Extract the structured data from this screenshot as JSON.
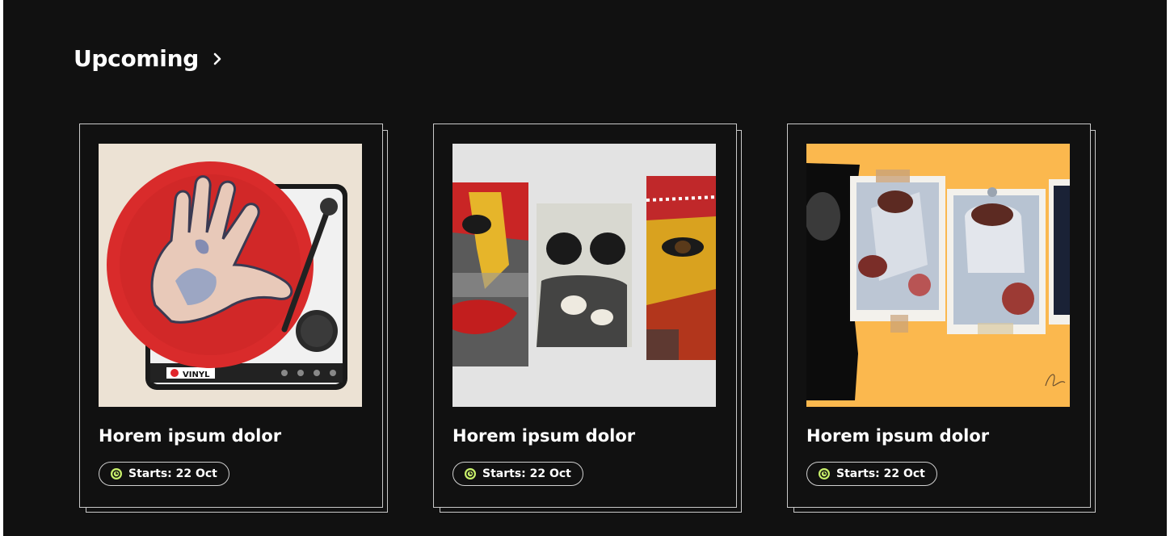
{
  "section": {
    "title": "Upcoming",
    "chevron_icon": "chevron-right-icon"
  },
  "colors": {
    "background": "#111111",
    "card_border": "#c9c9c9",
    "badge_icon": "#c8f06a"
  },
  "cards": [
    {
      "title": "Horem ipsum dolor",
      "badge_icon": "clock-icon",
      "badge_text": "Starts: 22 Oct",
      "image": "painting of a hand on a red vinyl record player",
      "image_lettering": "VINYL"
    },
    {
      "title": "Horem ipsum dolor",
      "badge_icon": "clock-icon",
      "badge_text": "Starts: 22 Oct",
      "image": "three painted tribal face panels on a grey background"
    },
    {
      "title": "Horem ipsum dolor",
      "badge_icon": "clock-icon",
      "badge_text": "Starts: 22 Oct",
      "image": "collage of teapot paintings on an orange background"
    }
  ]
}
